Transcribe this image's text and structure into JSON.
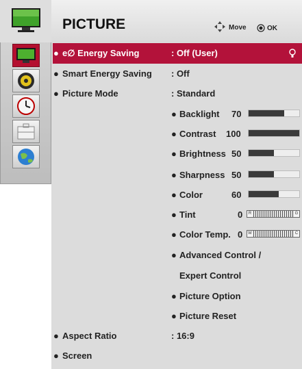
{
  "header": {
    "title": "PICTURE",
    "move_label": "Move",
    "ok_label": "OK"
  },
  "sidebar": {
    "items": [
      {
        "name": "picture",
        "icon": "tv-icon"
      },
      {
        "name": "audio",
        "icon": "speaker-icon"
      },
      {
        "name": "time",
        "icon": "clock-icon"
      },
      {
        "name": "option",
        "icon": "briefcase-icon"
      },
      {
        "name": "network",
        "icon": "globe-icon"
      }
    ]
  },
  "menu": {
    "energy_saving": {
      "label": "e∅ Energy Saving",
      "value": ": Off (User)"
    },
    "smart_energy_saving": {
      "label": "Smart Energy Saving",
      "value": ": Off"
    },
    "picture_mode": {
      "label": "Picture Mode",
      "value": ": Standard"
    },
    "backlight": {
      "label": "Backlight",
      "value": "70",
      "level": 0.7
    },
    "contrast": {
      "label": "Contrast",
      "value": "100",
      "level": 1.0
    },
    "brightness": {
      "label": "Brightness",
      "value": "50",
      "level": 0.5
    },
    "sharpness": {
      "label": "Sharpness",
      "value": "50",
      "level": 0.5
    },
    "color": {
      "label": "Color",
      "value": "60",
      "level": 0.6
    },
    "tint": {
      "label": "Tint",
      "value": "0",
      "left": "R",
      "right": "G"
    },
    "color_temp": {
      "label": "Color Temp.",
      "value": "0",
      "left": "W",
      "right": "C"
    },
    "advanced_control": {
      "label": "Advanced Control /"
    },
    "expert_control": {
      "label": "Expert Control"
    },
    "picture_option": {
      "label": "Picture Option"
    },
    "picture_reset": {
      "label": "Picture Reset"
    },
    "aspect_ratio": {
      "label": "Aspect Ratio",
      "value": ": 16:9"
    },
    "screen": {
      "label": "Screen"
    }
  },
  "colors": {
    "highlight": "#b3123a",
    "panel": "#dcdcdc",
    "bar_fill": "#3a3a3a"
  }
}
